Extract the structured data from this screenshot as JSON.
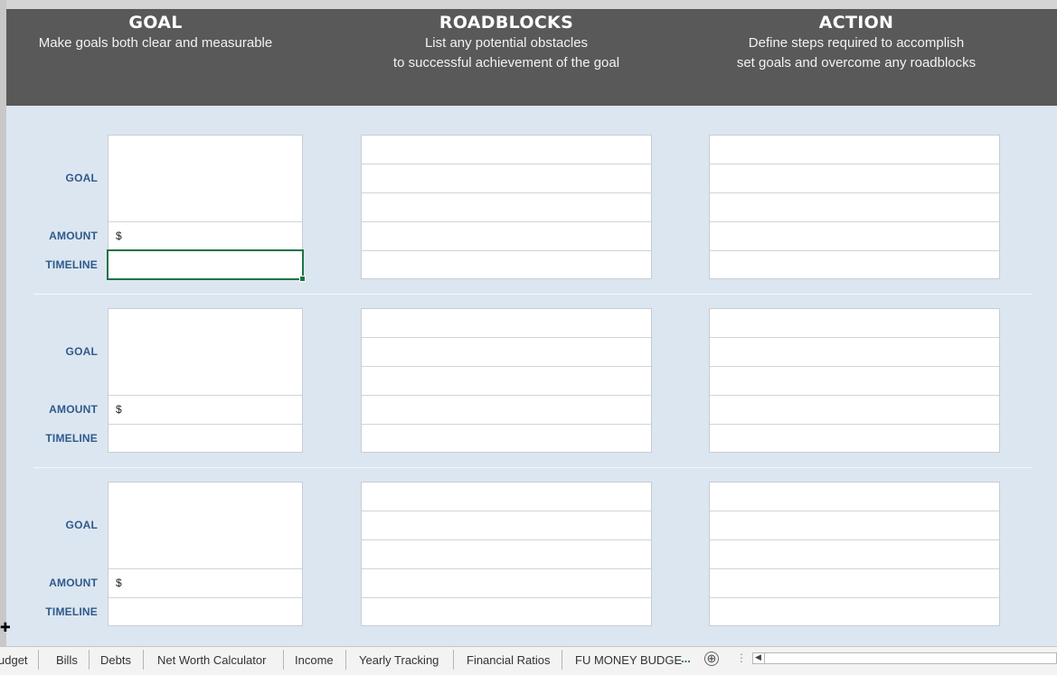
{
  "header": {
    "goal": {
      "title": "GOAL",
      "subtitle_lines": [
        "Make goals both clear and measurable"
      ]
    },
    "roadblocks": {
      "title": "ROADBLOCKS",
      "subtitle_lines": [
        "List any potential obstacles",
        "to successful achievement of the goal"
      ]
    },
    "action": {
      "title": "ACTION",
      "subtitle_lines": [
        "Define steps required to accomplish",
        "set goals and overcome any roadblocks"
      ]
    }
  },
  "labels": {
    "goal": "GOAL",
    "amount": "AMOUNT",
    "timeline": "TIMELINE",
    "currency": "$"
  },
  "blocks": [
    {
      "goal": "",
      "amount": "",
      "timeline": "",
      "roadblocks": [
        "",
        "",
        "",
        "",
        ""
      ],
      "actions": [
        "",
        "",
        "",
        "",
        ""
      ],
      "timeline_selected": true
    },
    {
      "goal": "",
      "amount": "",
      "timeline": "",
      "roadblocks": [
        "",
        "",
        "",
        "",
        ""
      ],
      "actions": [
        "",
        "",
        "",
        "",
        ""
      ],
      "timeline_selected": false
    },
    {
      "goal": "",
      "amount": "",
      "timeline": "",
      "roadblocks": [
        "",
        "",
        "",
        "",
        ""
      ],
      "actions": [
        "",
        "",
        "",
        "",
        ""
      ],
      "timeline_selected": false
    }
  ],
  "sheet_tabs": [
    "udget",
    "Bills",
    "Debts",
    "Net Worth Calculator",
    "Income",
    "Yearly Tracking",
    "Financial Ratios",
    "FU MONEY BUDGE"
  ],
  "tab_overflow": "...",
  "add_sheet": "⊕",
  "colors": {
    "header_bg": "#595959",
    "sheet_bg": "#dce6f1",
    "label": "#2e5a8a",
    "selection": "#217346"
  }
}
